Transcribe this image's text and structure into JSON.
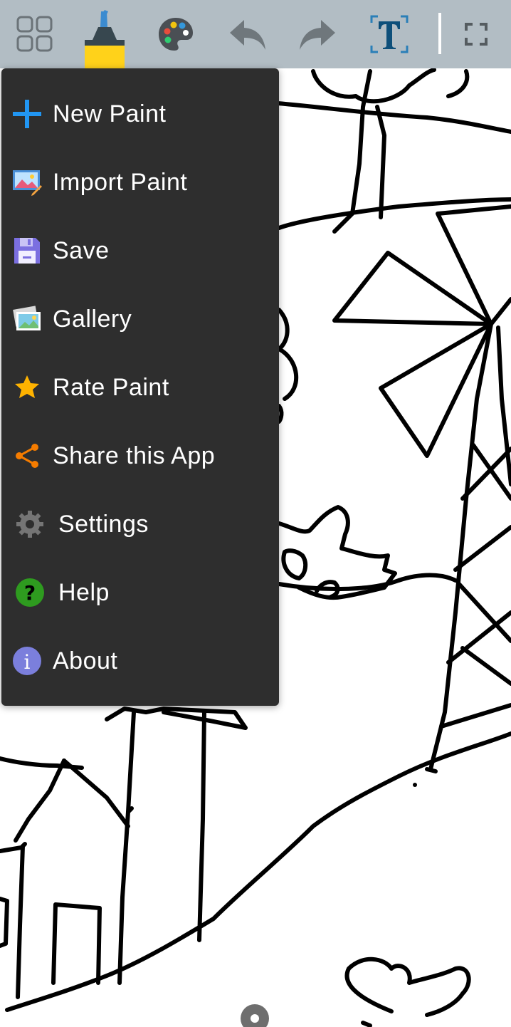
{
  "toolbar": {
    "buttons": [
      {
        "name": "grid-menu-icon"
      },
      {
        "name": "marker-icon",
        "colors": {
          "tip": "#3b8bd0",
          "body": "#37474f",
          "base": "#ffd21a"
        }
      },
      {
        "name": "palette-icon"
      },
      {
        "name": "undo-icon"
      },
      {
        "name": "redo-icon"
      },
      {
        "name": "text-tool-icon"
      },
      {
        "name": "fullscreen-icon"
      }
    ]
  },
  "menu": {
    "items": [
      {
        "label": "New Paint",
        "icon": "plus-icon"
      },
      {
        "label": "Import Paint",
        "icon": "import-image-icon"
      },
      {
        "label": "Save",
        "icon": "floppy-disk-icon"
      },
      {
        "label": "Gallery",
        "icon": "gallery-icon"
      },
      {
        "label": "Rate Paint",
        "icon": "star-icon"
      },
      {
        "label": "Share this App",
        "icon": "share-icon"
      },
      {
        "label": "Settings",
        "icon": "gear-icon"
      },
      {
        "label": "Help",
        "icon": "help-icon"
      },
      {
        "label": "About",
        "icon": "info-icon"
      }
    ]
  },
  "colors": {
    "toolbar_bg": "#b2bdc4",
    "menu_bg": "#2e2e2e",
    "plus": "#2196f3",
    "star": "#ffb300",
    "share": "#f57c00",
    "gear": "#757575",
    "help": "#2e9b1f",
    "info": "#7b7fdc"
  }
}
